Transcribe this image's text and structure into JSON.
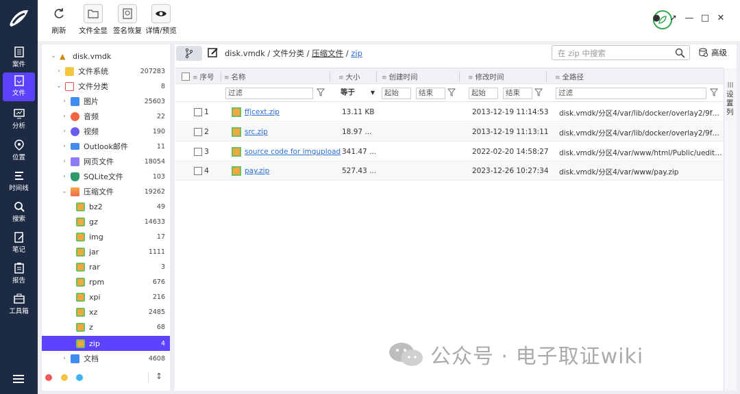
{
  "rail": {
    "items": [
      {
        "label": "案件",
        "icon": "case-icon"
      },
      {
        "label": "文件",
        "icon": "file-icon",
        "active": true
      },
      {
        "label": "分析",
        "icon": "analysis-icon"
      },
      {
        "label": "位置",
        "icon": "location-icon"
      },
      {
        "label": "时间线",
        "icon": "timeline-icon"
      },
      {
        "label": "搜索",
        "icon": "search-icon"
      },
      {
        "label": "笔记",
        "icon": "notes-icon"
      },
      {
        "label": "报告",
        "icon": "report-icon"
      },
      {
        "label": "工具箱",
        "icon": "toolbox-icon"
      }
    ]
  },
  "toolbar": {
    "refresh": "刷新",
    "show_all": "文件全显",
    "signature_recover": "签名恢复",
    "details_preview": "详情/预览"
  },
  "tree": {
    "root": "disk.vmdk",
    "items": [
      {
        "label": "文件系统",
        "count": "207283"
      },
      {
        "label": "文件分类",
        "count": "8"
      },
      {
        "label": "图片",
        "count": "25603"
      },
      {
        "label": "音频",
        "count": "22"
      },
      {
        "label": "视频",
        "count": "190"
      },
      {
        "label": "Outlook邮件",
        "count": "11"
      },
      {
        "label": "网页文件",
        "count": "18054"
      },
      {
        "label": "SQLite文件",
        "count": "103"
      },
      {
        "label": "压缩文件",
        "count": "19262"
      },
      {
        "label": "bz2",
        "count": "49"
      },
      {
        "label": "gz",
        "count": "14633"
      },
      {
        "label": "img",
        "count": "17"
      },
      {
        "label": "jar",
        "count": "1111"
      },
      {
        "label": "rar",
        "count": "3"
      },
      {
        "label": "rpm",
        "count": "676"
      },
      {
        "label": "xpi",
        "count": "216"
      },
      {
        "label": "xz",
        "count": "2485"
      },
      {
        "label": "z",
        "count": "68"
      },
      {
        "label": "zip",
        "count": "4"
      },
      {
        "label": "文档",
        "count": "4608"
      }
    ]
  },
  "breadcrumb": {
    "p1": "disk.vmdk",
    "sep": " / ",
    "p2": "文件分类",
    "p3": "压缩文件",
    "p4": "zip"
  },
  "search": {
    "placeholder": "在 zip 中搜索",
    "advanced": "高级"
  },
  "columns": {
    "index": "序号",
    "name": "名称",
    "size": "大小",
    "created": "创建时间",
    "modified": "修改时间",
    "fullpath": "全路径"
  },
  "filters": {
    "filter": "过滤",
    "equals": "等于",
    "start": "起始",
    "end": "结束"
  },
  "rows": [
    {
      "idx": "1",
      "name": "ffjcext.zip",
      "size": "13.11 KB",
      "modified": "2013-12-19 11:14:53",
      "path": "disk.vmdk/分区4/var/lib/docker/overlay2/9f7b..."
    },
    {
      "idx": "2",
      "name": "src.zip",
      "size": "18.97 ...",
      "modified": "2013-12-19 11:13:11",
      "path": "disk.vmdk/分区4/var/lib/docker/overlay2/9f7b..."
    },
    {
      "idx": "3",
      "name": "source code for imgupload",
      "size": "341.47 ...",
      "modified": "2022-02-20 14:58:27",
      "path": "disk.vmdk/分区4/var/www/html/Public/uedito..."
    },
    {
      "idx": "4",
      "name": "pay.zip",
      "size": "527.43 ...",
      "modified": "2023-12-26 10:27:34",
      "path": "disk.vmdk/分区4/var/www/pay.zip"
    }
  ],
  "settings_col": "设置列",
  "watermark": "公众号 · 电子取证wiki",
  "colors": {
    "accent": "#5b43ff",
    "rail": "#1d2a44",
    "link": "#2a6fd6"
  }
}
